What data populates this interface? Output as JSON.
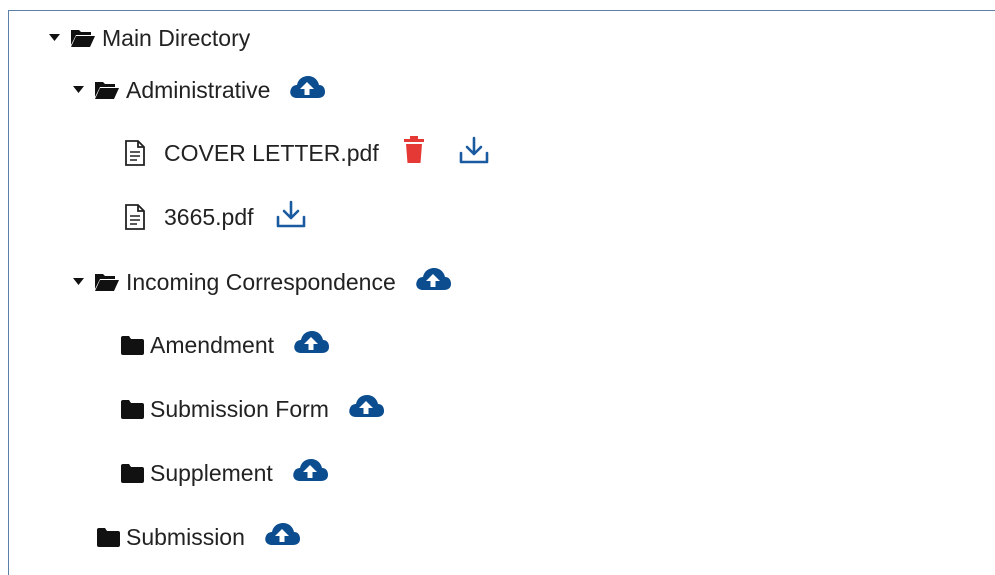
{
  "tree": {
    "root": {
      "label": "Main Directory"
    },
    "administrative": {
      "label": "Administrative",
      "files": [
        {
          "name": "COVER LETTER.pdf"
        },
        {
          "name": "3665.pdf"
        }
      ]
    },
    "incoming": {
      "label": "Incoming Correspondence",
      "children": [
        {
          "label": "Amendment"
        },
        {
          "label": "Submission Form"
        },
        {
          "label": "Supplement"
        }
      ]
    },
    "submission": {
      "label": "Submission"
    }
  },
  "colors": {
    "upload_icon": "#0b4d8f",
    "download_icon": "#1a5aa0",
    "trash_icon": "#e53935",
    "border": "#5b7fa6"
  },
  "icons": {
    "caret": "caret-down-icon",
    "open_folder": "folder-open-icon",
    "closed_folder": "folder-icon",
    "file": "file-icon",
    "upload": "cloud-upload-icon",
    "download": "download-icon",
    "delete": "trash-icon"
  }
}
